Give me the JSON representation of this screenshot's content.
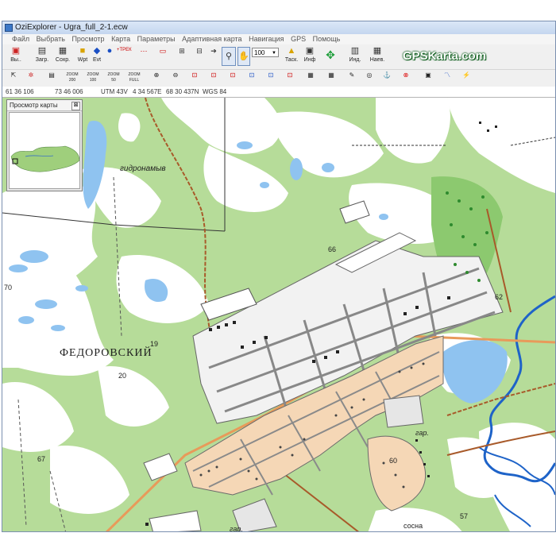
{
  "window": {
    "title": "OziExplorer - Ugra_full_2-1.ecw"
  },
  "menu": {
    "items": [
      "Файл",
      "Выбрать",
      "Просмотр",
      "Карта",
      "Параметры",
      "Адаптивная карта",
      "Навигация",
      "GPS",
      "Помощь"
    ]
  },
  "toolbar": {
    "exit_label": "Вы..",
    "load_label": "Загр.",
    "save_label": "Сохр.",
    "wpt_label": "Wpt",
    "evt_label": "Evt",
    "track_label": "+ТРЕК",
    "zoom_value": "100",
    "task_label": "Таск.",
    "info_label": "Инф",
    "ind_label": "Инд.",
    "nav_label": "Наев.",
    "zoom_labels": [
      "ZOOM 200",
      "ZOOM 100",
      "ZOOM 50",
      "ZOOM FULL"
    ]
  },
  "brand": {
    "text": "GPSKarta.com",
    "color": "#0a6b1f"
  },
  "status": {
    "lat": "61 36 106",
    "lon": "73 46 006",
    "utm": "UTM 43V",
    "easting": "4 34 567E",
    "northing": "68 30 437N",
    "datum": "WGS 84"
  },
  "preview": {
    "title": "Просмотр карты",
    "close": "⊠"
  },
  "map": {
    "labels": {
      "town": "ФЕДОРОВСКИЙ",
      "hydro": "гидронамыв",
      "gar1": "гар.",
      "gar2": "гар.",
      "sosna": "сосна",
      "n70": "70",
      "n66": "66",
      "n62": "62",
      "n20": "20",
      "n67": "67",
      "n60": "60",
      "n57": "57",
      "n19": "19"
    },
    "colors": {
      "forest": "#b6dc99",
      "open": "#ffffff",
      "water": "#8fc3f0",
      "residential": "#f5d7b6",
      "road": "#e89a5a",
      "block": "#f2f2f2"
    }
  }
}
